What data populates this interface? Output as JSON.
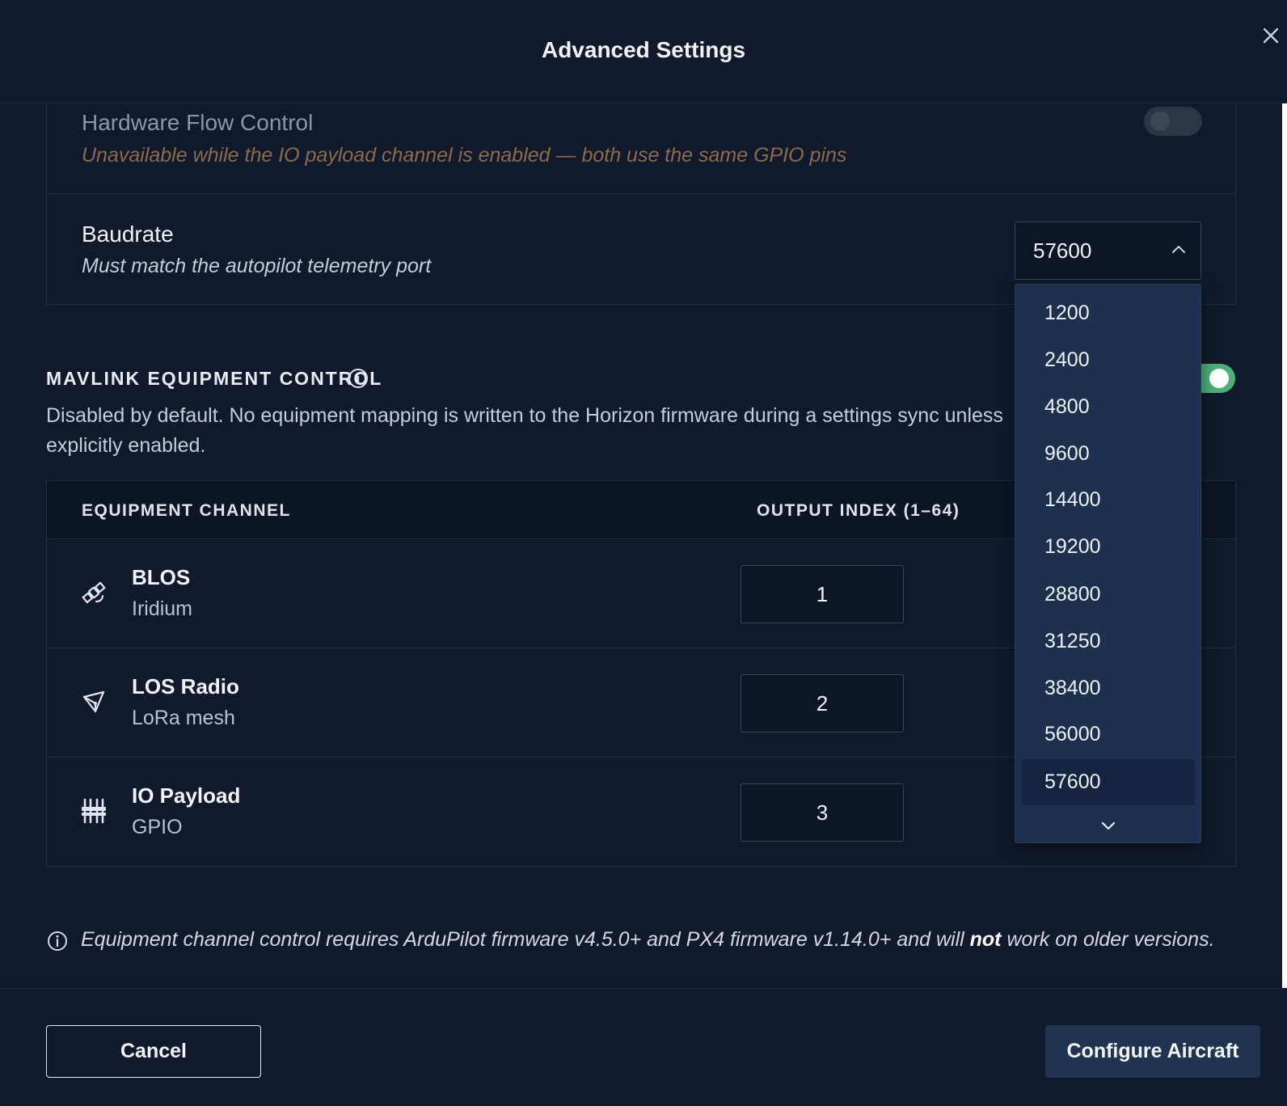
{
  "dialog": {
    "title": "Advanced Settings"
  },
  "icons": {
    "close": "close-icon",
    "info": "info-icon",
    "chevron_up": "chevron-up-icon",
    "chevron_down": "chevron-down-icon",
    "satellite": "satellite-icon",
    "radio": "radio-antenna-icon",
    "sliders": "sliders-icon"
  },
  "hardware_flow": {
    "title": "Hardware Flow Control",
    "subtitle": "Unavailable while the IO payload channel is enabled — both use the same GPIO pins",
    "enabled": false
  },
  "baudrate": {
    "title": "Baudrate",
    "subtitle": "Must match the autopilot telemetry port",
    "selected": "57600",
    "options": [
      "1200",
      "2400",
      "4800",
      "9600",
      "14400",
      "19200",
      "28800",
      "31250",
      "38400",
      "56000",
      "57600"
    ]
  },
  "mavlink": {
    "title": "MAVLINK EQUIPMENT CONTROL",
    "description": "Disabled by default. No equipment mapping is written to the Horizon firmware during a settings sync unless explicitly enabled.",
    "enabled": true
  },
  "table": {
    "headers": {
      "channel": "EQUIPMENT CHANNEL",
      "index": "OUTPUT INDEX (1–64)"
    },
    "rows": [
      {
        "name": "BLOS",
        "sub": "Iridium",
        "index": "1"
      },
      {
        "name": "LOS Radio",
        "sub": "LoRa mesh",
        "index": "2"
      },
      {
        "name": "IO Payload",
        "sub": "GPIO",
        "index": "3"
      }
    ]
  },
  "footnote": {
    "before": "Equipment channel control requires ArduPilot firmware v4.5.0+ and PX4 firmware v1.14.0+ and will ",
    "emphasis": "not",
    "after": " work on older versions."
  },
  "footer": {
    "cancel": "Cancel",
    "primary": "Configure Aircraft"
  },
  "colors": {
    "background": "#101a2c",
    "toggle_on": "#4caf7a",
    "dropdown_bg": "#1e3050",
    "warning_text": "#8f6a4a",
    "primary_button": "#203451"
  }
}
